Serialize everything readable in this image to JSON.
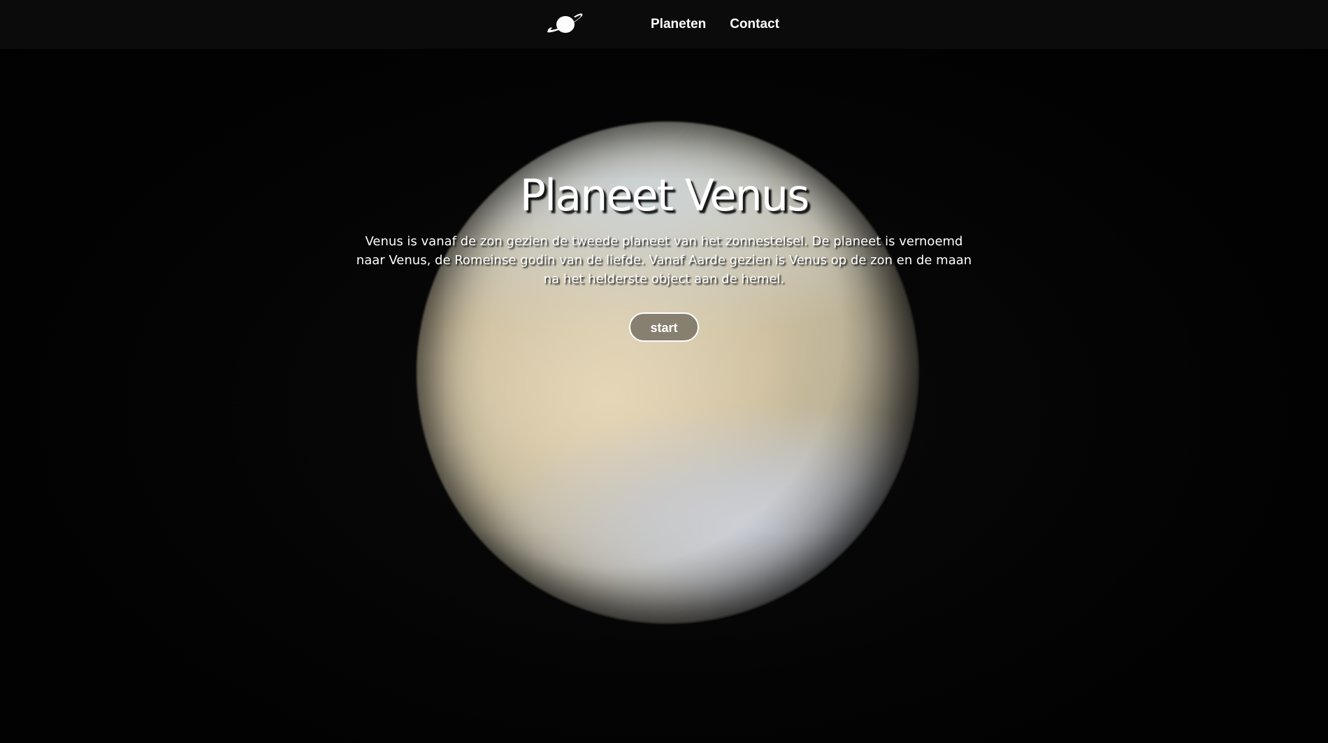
{
  "nav": {
    "logo_icon": "saturn-planet-icon",
    "links": [
      {
        "label": "Planeten"
      },
      {
        "label": "Contact"
      }
    ]
  },
  "hero": {
    "title": "Planeet Venus",
    "description": "Venus is vanaf de zon gezien de tweede planeet van het zonnestelsel. De planeet is vernoemd naar Venus, de Romeinse godin van de liefde. Vanaf Aarde gezien is Venus op de zon en de maan na het helderste object aan de hemel.",
    "button_label": "start",
    "background_image": "venus-planet-image"
  },
  "colors": {
    "navbar": "#0b0b0b",
    "background": "#020202",
    "button_fill": "#787264",
    "text": "#ffffff"
  }
}
